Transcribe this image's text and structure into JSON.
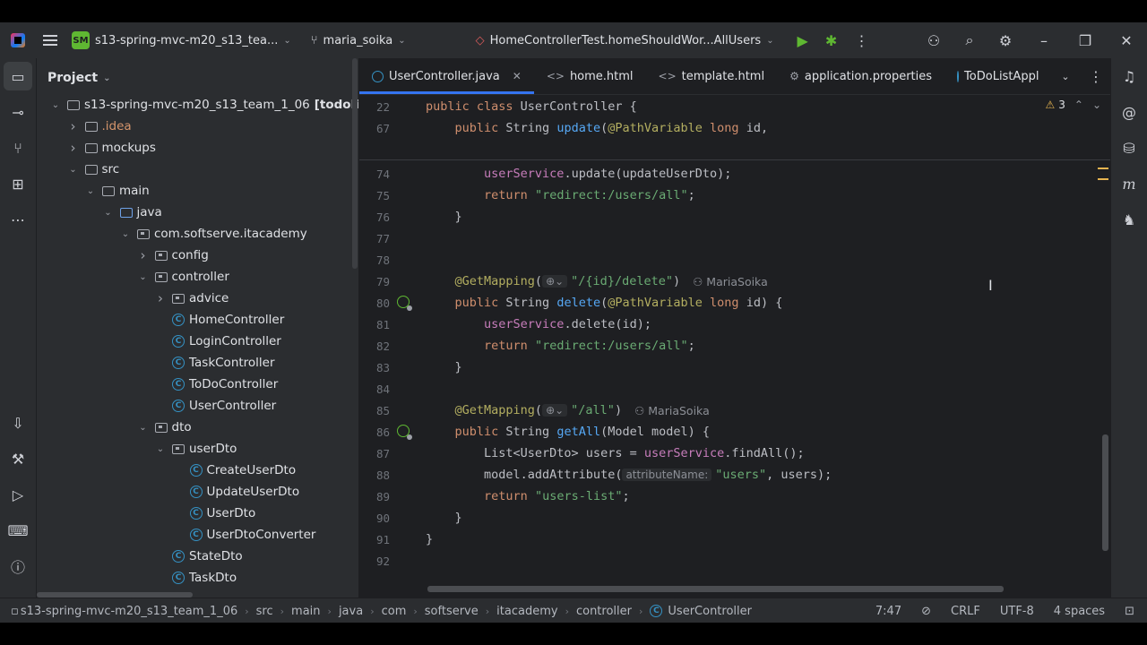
{
  "titlebar": {
    "project_badge": "SM",
    "project_name": "s13-spring-mvc-m20_s13_tea...",
    "vcs_branch": "maria_soika",
    "run_config": "HomeControllerTest.homeShouldWor...AllUsers"
  },
  "project_panel": {
    "title": "Project",
    "tree": [
      {
        "label": "s13-spring-mvc-m20_s13_team_1_06",
        "suffix": "[todolist]",
        "indent": 0,
        "arrow": "down",
        "icon": "folder"
      },
      {
        "label": ".idea",
        "indent": 1,
        "arrow": "right",
        "icon": "folder",
        "color": "orange"
      },
      {
        "label": "mockups",
        "indent": 1,
        "arrow": "right",
        "icon": "folder"
      },
      {
        "label": "src",
        "indent": 1,
        "arrow": "down",
        "icon": "folder"
      },
      {
        "label": "main",
        "indent": 2,
        "arrow": "down",
        "icon": "folder"
      },
      {
        "label": "java",
        "indent": 3,
        "arrow": "down",
        "icon": "src-folder"
      },
      {
        "label": "com.softserve.itacademy",
        "indent": 4,
        "arrow": "down",
        "icon": "package"
      },
      {
        "label": "config",
        "indent": 5,
        "arrow": "right",
        "icon": "package"
      },
      {
        "label": "controller",
        "indent": 5,
        "arrow": "down",
        "icon": "package"
      },
      {
        "label": "advice",
        "indent": 6,
        "arrow": "right",
        "icon": "package"
      },
      {
        "label": "HomeController",
        "indent": 6,
        "arrow": "none",
        "icon": "class"
      },
      {
        "label": "LoginController",
        "indent": 6,
        "arrow": "none",
        "icon": "class"
      },
      {
        "label": "TaskController",
        "indent": 6,
        "arrow": "none",
        "icon": "class"
      },
      {
        "label": "ToDoController",
        "indent": 6,
        "arrow": "none",
        "icon": "class"
      },
      {
        "label": "UserController",
        "indent": 6,
        "arrow": "none",
        "icon": "class"
      },
      {
        "label": "dto",
        "indent": 5,
        "arrow": "down",
        "icon": "package"
      },
      {
        "label": "userDto",
        "indent": 6,
        "arrow": "down",
        "icon": "package"
      },
      {
        "label": "CreateUserDto",
        "indent": 7,
        "arrow": "none",
        "icon": "class"
      },
      {
        "label": "UpdateUserDto",
        "indent": 7,
        "arrow": "none",
        "icon": "class"
      },
      {
        "label": "UserDto",
        "indent": 7,
        "arrow": "none",
        "icon": "class"
      },
      {
        "label": "UserDtoConverter",
        "indent": 7,
        "arrow": "none",
        "icon": "class"
      },
      {
        "label": "StateDto",
        "indent": 6,
        "arrow": "none",
        "icon": "class"
      },
      {
        "label": "TaskDto",
        "indent": 6,
        "arrow": "none",
        "icon": "class"
      }
    ]
  },
  "editor": {
    "tabs": [
      {
        "label": "UserController.java",
        "icon": "class",
        "active": true,
        "closable": true
      },
      {
        "label": "home.html",
        "icon": "html"
      },
      {
        "label": "template.html",
        "icon": "html"
      },
      {
        "label": "application.properties",
        "icon": "properties"
      },
      {
        "label": "ToDoListAppl",
        "icon": "class"
      }
    ],
    "warnings_count": "3",
    "sticky_lines": [
      {
        "n": "22",
        "tokens": [
          [
            "kw",
            "public class "
          ],
          [
            "src",
            "UserController {"
          ]
        ]
      },
      {
        "n": "67",
        "tokens": [
          [
            "src",
            "    "
          ],
          [
            "kw",
            "public "
          ],
          [
            "src",
            "String "
          ],
          [
            "fn",
            "update"
          ],
          [
            "src",
            "("
          ],
          [
            "an",
            "@PathVariable "
          ],
          [
            "kw",
            "long "
          ],
          [
            "src",
            "id,"
          ]
        ]
      }
    ],
    "lines": [
      {
        "n": "74",
        "tokens": [
          [
            "src",
            "        "
          ],
          [
            "fld",
            "userService"
          ],
          [
            "src",
            ".update(updateUserDto);"
          ]
        ]
      },
      {
        "n": "75",
        "tokens": [
          [
            "src",
            "        "
          ],
          [
            "kw",
            "return "
          ],
          [
            "str",
            "\"redirect:/users/all\""
          ],
          [
            "src",
            ";"
          ]
        ]
      },
      {
        "n": "76",
        "tokens": [
          [
            "src",
            "    }"
          ]
        ]
      },
      {
        "n": "77",
        "tokens": []
      },
      {
        "n": "78",
        "tokens": []
      },
      {
        "n": "79",
        "tokens": [
          [
            "src",
            "    "
          ],
          [
            "an",
            "@GetMapping"
          ],
          [
            "src",
            "("
          ],
          [
            "hint",
            "⊕⌄"
          ],
          [
            "str",
            "\"/{id}/delete\""
          ],
          [
            "src",
            ")"
          ],
          [
            "author",
            "MariaSoika"
          ]
        ]
      },
      {
        "n": "80",
        "gutter": "spring",
        "tokens": [
          [
            "src",
            "    "
          ],
          [
            "kw",
            "public "
          ],
          [
            "src",
            "String "
          ],
          [
            "fn",
            "delete"
          ],
          [
            "src",
            "("
          ],
          [
            "an",
            "@PathVariable "
          ],
          [
            "kw",
            "long "
          ],
          [
            "src",
            "id) {"
          ]
        ]
      },
      {
        "n": "81",
        "tokens": [
          [
            "src",
            "        "
          ],
          [
            "fld",
            "userService"
          ],
          [
            "src",
            ".delete(id);"
          ]
        ]
      },
      {
        "n": "82",
        "tokens": [
          [
            "src",
            "        "
          ],
          [
            "kw",
            "return "
          ],
          [
            "str",
            "\"redirect:/users/all\""
          ],
          [
            "src",
            ";"
          ]
        ]
      },
      {
        "n": "83",
        "tokens": [
          [
            "src",
            "    }"
          ]
        ]
      },
      {
        "n": "84",
        "tokens": []
      },
      {
        "n": "85",
        "tokens": [
          [
            "src",
            "    "
          ],
          [
            "an",
            "@GetMapping"
          ],
          [
            "src",
            "("
          ],
          [
            "hint",
            "⊕⌄"
          ],
          [
            "str",
            "\"/all\""
          ],
          [
            "src",
            ")"
          ],
          [
            "author",
            "MariaSoika"
          ]
        ]
      },
      {
        "n": "86",
        "gutter": "spring",
        "tokens": [
          [
            "src",
            "    "
          ],
          [
            "kw",
            "public "
          ],
          [
            "src",
            "String "
          ],
          [
            "fn",
            "getAll"
          ],
          [
            "src",
            "(Model model) {"
          ]
        ]
      },
      {
        "n": "87",
        "tokens": [
          [
            "src",
            "        List<UserDto> users = "
          ],
          [
            "fld",
            "userService"
          ],
          [
            "src",
            ".findAll();"
          ]
        ]
      },
      {
        "n": "88",
        "tokens": [
          [
            "src",
            "        model.addAttribute("
          ],
          [
            "hint",
            "attributeName:"
          ],
          [
            "str",
            "\"users\""
          ],
          [
            "src",
            ", users);"
          ]
        ]
      },
      {
        "n": "89",
        "tokens": [
          [
            "src",
            "        "
          ],
          [
            "kw",
            "return "
          ],
          [
            "str",
            "\"users-list\""
          ],
          [
            "src",
            ";"
          ]
        ]
      },
      {
        "n": "90",
        "tokens": [
          [
            "src",
            "    }"
          ]
        ]
      },
      {
        "n": "91",
        "tokens": [
          [
            "src",
            "}"
          ]
        ]
      },
      {
        "n": "92",
        "tokens": []
      }
    ]
  },
  "statusbar": {
    "breadcrumbs": [
      "s13-spring-mvc-m20_s13_team_1_06",
      "src",
      "main",
      "java",
      "com",
      "softserve",
      "itacademy",
      "controller",
      "UserController"
    ],
    "position": "7:47",
    "line_ending": "CRLF",
    "encoding": "UTF-8",
    "indent": "4 spaces"
  },
  "colors": {
    "accent": "#3574f0",
    "keyword": "#cf8e6d",
    "string": "#6aab73",
    "function": "#56a8f5",
    "annotation": "#b3ae60",
    "field": "#c77dbb"
  }
}
